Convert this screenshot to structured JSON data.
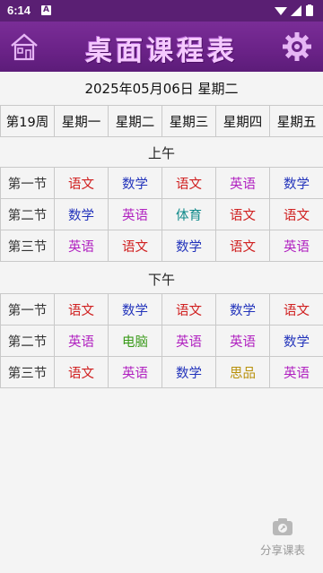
{
  "status_bar": {
    "time": "6:14",
    "notification_badge": "A"
  },
  "header": {
    "title": "桌面课程表",
    "icons": [
      "home-icon",
      "settings-gear-icon"
    ],
    "accent_color": "#6a2287"
  },
  "date_line": "2025年05月06日 星期二",
  "week_row": {
    "week_label": "第19周",
    "days": [
      "星期一",
      "星期二",
      "星期三",
      "星期四",
      "星期五"
    ]
  },
  "morning": {
    "label": "上午",
    "rows": [
      {
        "period": "第一节",
        "classes": [
          {
            "name": "语文",
            "color": "#d02020"
          },
          {
            "name": "数学",
            "color": "#2233bb"
          },
          {
            "name": "语文",
            "color": "#d02020"
          },
          {
            "name": "英语",
            "color": "#b020c0"
          },
          {
            "name": "数学",
            "color": "#2233bb"
          }
        ]
      },
      {
        "period": "第二节",
        "classes": [
          {
            "name": "数学",
            "color": "#2233bb"
          },
          {
            "name": "英语",
            "color": "#b020c0"
          },
          {
            "name": "体育",
            "color": "#108a8a"
          },
          {
            "name": "语文",
            "color": "#d02020"
          },
          {
            "name": "语文",
            "color": "#d02020"
          }
        ]
      },
      {
        "period": "第三节",
        "classes": [
          {
            "name": "英语",
            "color": "#b020c0"
          },
          {
            "name": "语文",
            "color": "#d02020"
          },
          {
            "name": "数学",
            "color": "#2233bb"
          },
          {
            "name": "语文",
            "color": "#d02020"
          },
          {
            "name": "英语",
            "color": "#b020c0"
          }
        ]
      }
    ]
  },
  "afternoon": {
    "label": "下午",
    "rows": [
      {
        "period": "第一节",
        "classes": [
          {
            "name": "语文",
            "color": "#d02020"
          },
          {
            "name": "数学",
            "color": "#2233bb"
          },
          {
            "name": "语文",
            "color": "#d02020"
          },
          {
            "name": "数学",
            "color": "#2233bb"
          },
          {
            "name": "语文",
            "color": "#d02020"
          }
        ]
      },
      {
        "period": "第二节",
        "classes": [
          {
            "name": "英语",
            "color": "#b020c0"
          },
          {
            "name": "电脑",
            "color": "#3a9a1a"
          },
          {
            "name": "英语",
            "color": "#b020c0"
          },
          {
            "name": "英语",
            "color": "#b020c0"
          },
          {
            "name": "数学",
            "color": "#2233bb"
          }
        ]
      },
      {
        "period": "第三节",
        "classes": [
          {
            "name": "语文",
            "color": "#d02020"
          },
          {
            "name": "英语",
            "color": "#b020c0"
          },
          {
            "name": "数学",
            "color": "#2233bb"
          },
          {
            "name": "思品",
            "color": "#b8900a"
          },
          {
            "name": "英语",
            "color": "#b020c0"
          }
        ]
      }
    ]
  },
  "share": {
    "label": "分享课表",
    "icon": "camera-share-icon"
  }
}
